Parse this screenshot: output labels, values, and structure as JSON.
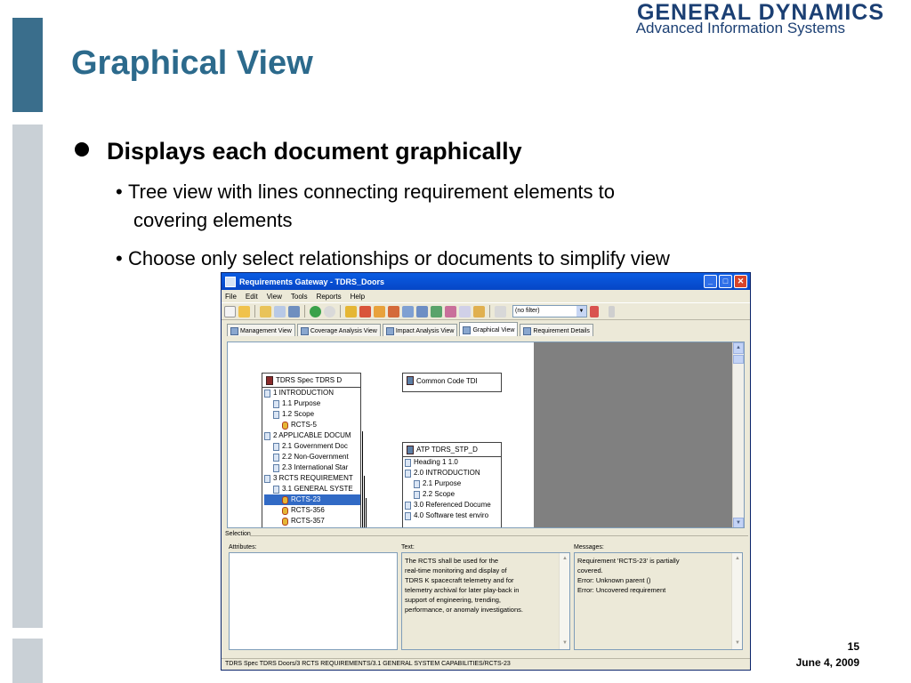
{
  "slide": {
    "title": "Graphical View",
    "bullet": "Displays each document graphically",
    "sub_bullets": [
      {
        "line1": "Tree view with lines connecting requirement elements to",
        "line2": "covering elements"
      },
      {
        "line1": "Choose only select relationships or documents to simplify view"
      }
    ],
    "page_number": "15",
    "date": "June 4, 2009"
  },
  "logo": {
    "name": "GENERAL DYNAMICS",
    "division": "Advanced Information Systems"
  },
  "app": {
    "title": "Requirements Gateway - TDRS_Doors",
    "menu": [
      "File",
      "Edit",
      "View",
      "Tools",
      "Reports",
      "Help"
    ],
    "filter_value": "(no filter)",
    "tabs": [
      "Management View",
      "Coverage Analysis View",
      "Impact Analysis View",
      "Graphical View",
      "Requirement Details"
    ],
    "doc_left": {
      "header": "TDRS Spec   TDRS D",
      "rows": [
        "1 INTRODUCTION",
        "1.1 Purpose",
        "1.2 Scope",
        "RCTS-5",
        "2 APPLICABLE DOCUM",
        "2.1 Government Doc",
        "2.2 Non-Government",
        "2.3 International Star",
        "3 RCTS REQUIREMENT",
        "3.1 GENERAL SYSTE",
        "RCTS-23",
        "RCTS-356",
        "RCTS-357"
      ]
    },
    "doc_common": {
      "header": "Common Code   TDI"
    },
    "doc_atp": {
      "header": "ATP   TDRS_STP_D",
      "rows": [
        "Heading 1            1.0",
        "2.0 INTRODUCTION",
        "2.1 Purpose",
        "2.2 Scope",
        "3.0 Referenced Docume",
        "4.0 Software test enviro"
      ]
    },
    "selection": {
      "label": "Selection",
      "attributes_label": "Attributes:",
      "text_label": "Text:",
      "messages_label": "Messages:",
      "text_lines": [
        "The RCTS shall be used for the",
        "real-time monitoring and display of",
        "TDRS K spacecraft telemetry and for",
        "telemetry archival for later play-back in",
        "support of engineering, trending,",
        "performance, or anomaly investigations."
      ],
      "messages_lines": [
        "Requirement 'RCTS-23' is partially",
        "covered.",
        "Error: Unknown parent ()",
        "Error: Uncovered requirement"
      ]
    },
    "status": "TDRS Spec    TDRS Doors/3 RCTS REQUIREMENTS/3.1 GENERAL SYSTEM CAPABILITIES/RCTS-23"
  }
}
